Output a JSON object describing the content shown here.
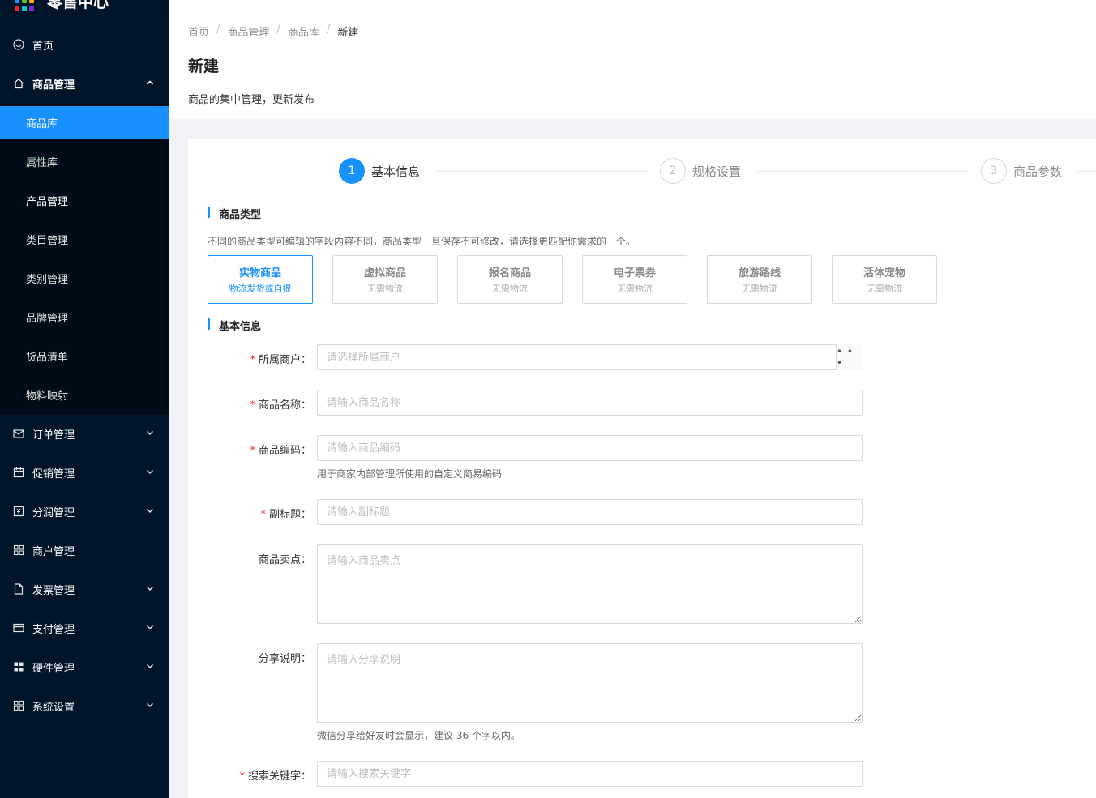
{
  "app": {
    "title": "零售中心"
  },
  "sidebar": {
    "items": [
      {
        "label": "首页",
        "icon": "dashboard-icon"
      },
      {
        "label": "商品管理",
        "icon": "home-icon",
        "expanded": true
      },
      {
        "label": "订单管理",
        "icon": "mail-icon"
      },
      {
        "label": "促销管理",
        "icon": "calendar-icon"
      },
      {
        "label": "分润管理",
        "icon": "money-icon"
      },
      {
        "label": "商户管理",
        "icon": "appstore-icon"
      },
      {
        "label": "发票管理",
        "icon": "file-icon"
      },
      {
        "label": "支付管理",
        "icon": "credit-card-icon"
      },
      {
        "label": "硬件管理",
        "icon": "grid-icon"
      },
      {
        "label": "系统设置",
        "icon": "appstore-icon"
      }
    ],
    "sub_items": [
      {
        "label": "商品库",
        "active": true
      },
      {
        "label": "属性库"
      },
      {
        "label": "产品管理"
      },
      {
        "label": "类目管理"
      },
      {
        "label": "类别管理"
      },
      {
        "label": "品牌管理"
      },
      {
        "label": "货品清单"
      },
      {
        "label": "物料映射"
      }
    ]
  },
  "breadcrumb": [
    "首页",
    "商品管理",
    "商品库",
    "新建"
  ],
  "page": {
    "title": "新建",
    "description": "商品的集中管理，更新发布"
  },
  "steps": [
    {
      "num": "1",
      "title": "基本信息",
      "status": "active"
    },
    {
      "num": "2",
      "title": "规格设置",
      "status": "wait"
    },
    {
      "num": "3",
      "title": "商品参数",
      "status": "wait"
    }
  ],
  "product_type": {
    "title": "商品类型",
    "hint": "不同的商品类型可编辑的字段内容不同，商品类型一旦保存不可修改，请选择更匹配你需求的一个。",
    "options": [
      {
        "name": "实物商品",
        "sub": "物流发货或自提",
        "selected": true
      },
      {
        "name": "虚拟商品",
        "sub": "无需物流"
      },
      {
        "name": "报名商品",
        "sub": "无需物流"
      },
      {
        "name": "电子票券",
        "sub": "无需物流"
      },
      {
        "name": "旅游路线",
        "sub": "无需物流"
      },
      {
        "name": "活体宠物",
        "sub": "无需物流"
      }
    ]
  },
  "basic_info": {
    "title": "基本信息",
    "merchant": {
      "label": "所属商户：",
      "placeholder": "请选择所属商户",
      "addon": "• • •"
    },
    "name": {
      "label": "商品名称：",
      "placeholder": "请输入商品名称"
    },
    "code": {
      "label": "商品编码：",
      "placeholder": "请输入商品编码",
      "help": "用于商家内部管理所使用的自定义简易编码"
    },
    "subtitle": {
      "label": "副标题：",
      "placeholder": "请输入副标题"
    },
    "selling_point": {
      "label": "商品卖点：",
      "placeholder": "请输入商品卖点"
    },
    "share_desc": {
      "label": "分享说明：",
      "placeholder": "请输入分享说明",
      "help": "微信分享给好友时会显示，建议 36 个字以内。"
    },
    "keywords": {
      "label": "搜索关键字：",
      "placeholder": "请输入搜索关键字"
    }
  },
  "colors": {
    "primary": "#1890ff",
    "sidebar_bg": "#001529",
    "submenu_bg": "#000c17",
    "required": "#f5222d"
  }
}
